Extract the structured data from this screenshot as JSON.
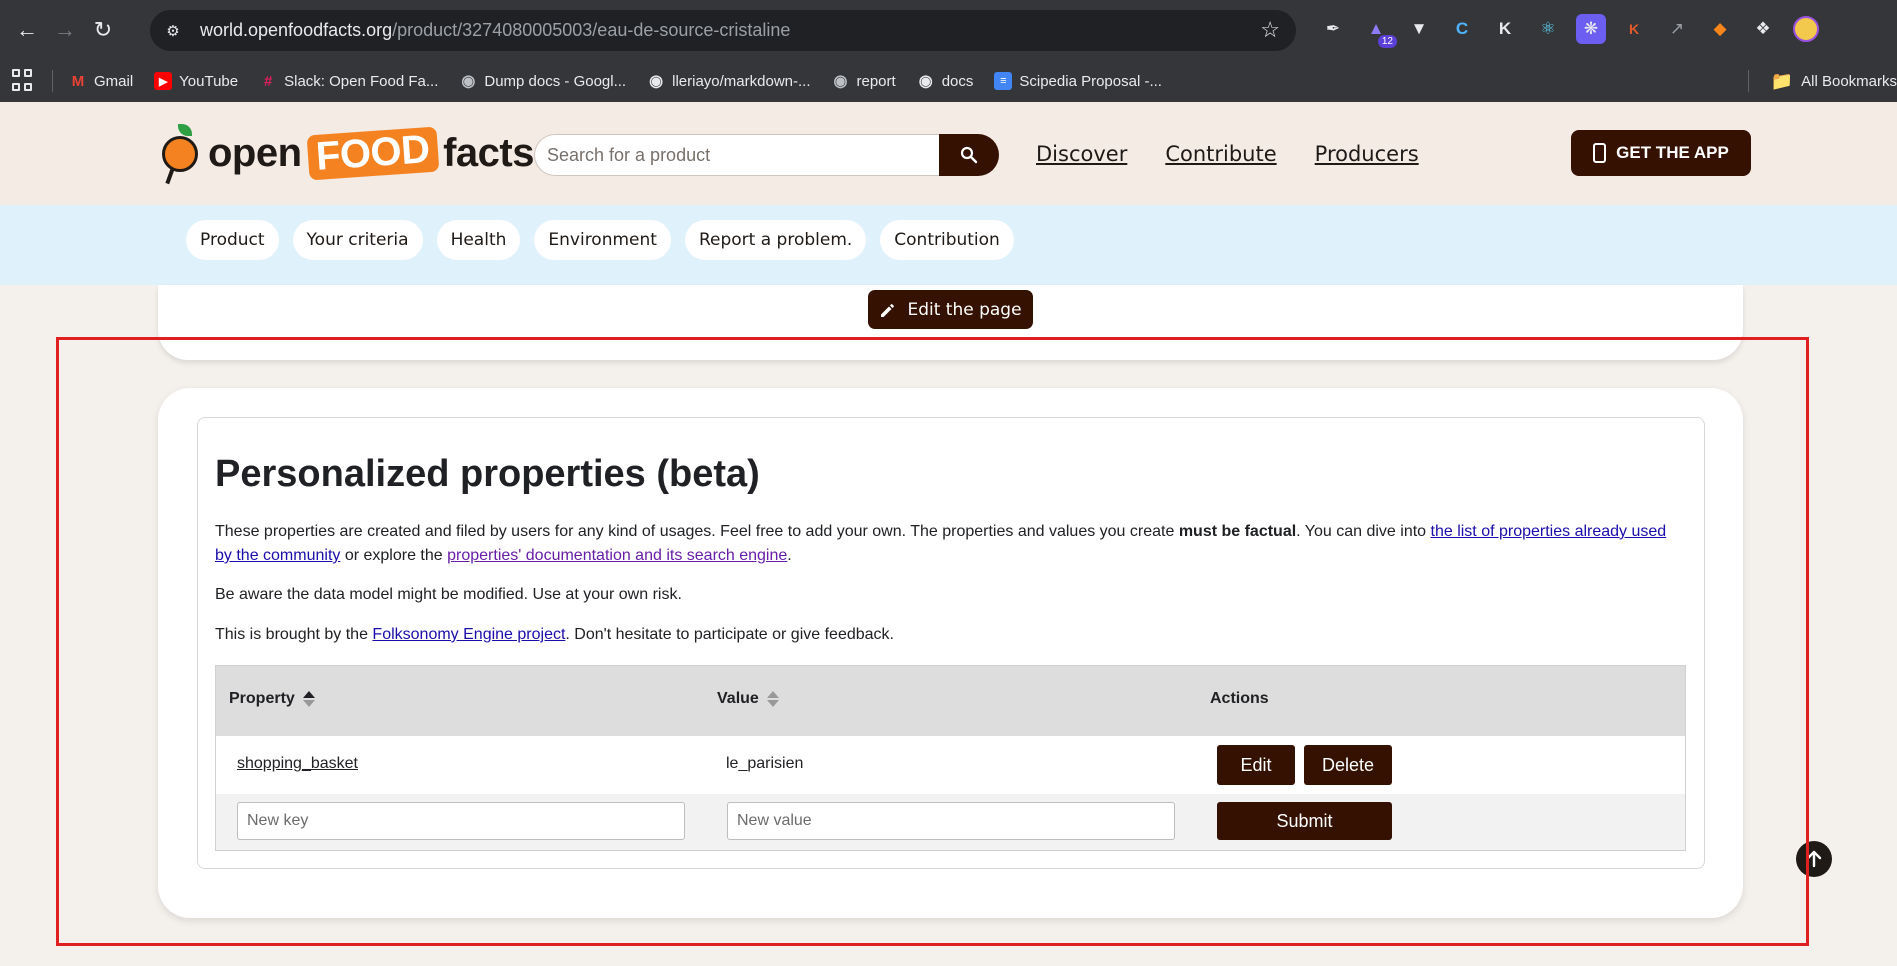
{
  "browser": {
    "url_host": "world.openfoodfacts.org",
    "url_path": "/product/3274080005003/eau-de-source-cristaline",
    "extension_badge": "12",
    "bookmarks": [
      {
        "label": "Gmail",
        "icon": "gmail-icon",
        "color": "#ea4335"
      },
      {
        "label": "YouTube",
        "icon": "youtube-icon",
        "color": "#ff0000"
      },
      {
        "label": "Slack: Open Food Fa...",
        "icon": "slack-icon",
        "color": "#4a154b"
      },
      {
        "label": "Dump docs - Googl...",
        "icon": "globe-icon",
        "color": "#5f6368"
      },
      {
        "label": "lleriayo/markdown-...",
        "icon": "github-icon",
        "color": "#24292e"
      },
      {
        "label": "report",
        "icon": "globe-icon",
        "color": "#5f6368"
      },
      {
        "label": "docs",
        "icon": "github-icon",
        "color": "#24292e"
      },
      {
        "label": "Scipedia Proposal -...",
        "icon": "google-docs-icon",
        "color": "#4285f4"
      }
    ],
    "all_bookmarks": "All Bookmarks"
  },
  "site": {
    "logo_open": "open",
    "logo_food": "FOOD",
    "logo_facts": "facts",
    "search_placeholder": "Search for a product",
    "nav": [
      "Discover",
      "Contribute",
      "Producers"
    ],
    "get_app": "GET THE APP",
    "subnav": [
      "Product",
      "Your criteria",
      "Health",
      "Environment",
      "Report a problem.",
      "Contribution"
    ],
    "edit_page": "Edit the page"
  },
  "properties": {
    "title": "Personalized properties (beta)",
    "p1_a": "These properties are created and filed by users for any kind of usages. Feel free to add your own. The properties and values you create ",
    "p1_bold": "must be factual",
    "p1_b": ". You can dive into ",
    "p1_link1": "the list of properties already used by the community",
    "p1_c": " or explore the ",
    "p1_link2": "properties' documentation and its search engine",
    "p1_d": ".",
    "p2": "Be aware the data model might be modified. Use at your own risk.",
    "p3_a": "This is brought by the ",
    "p3_link": "Folksonomy Engine project",
    "p3_b": ". Don't hesitate to participate or give feedback.",
    "table": {
      "headers": [
        "Property",
        "Value",
        "Actions"
      ],
      "rows": [
        {
          "property": "shopping_basket",
          "value": "le_parisien",
          "edit": "Edit",
          "delete": "Delete"
        }
      ],
      "new_key_placeholder": "New key",
      "new_value_placeholder": "New value",
      "submit": "Submit"
    }
  },
  "colors": {
    "brand_dark": "#341100",
    "brand_orange": "#f58220",
    "subnav_bg": "#dff1fb",
    "highlight": "#e02020"
  }
}
